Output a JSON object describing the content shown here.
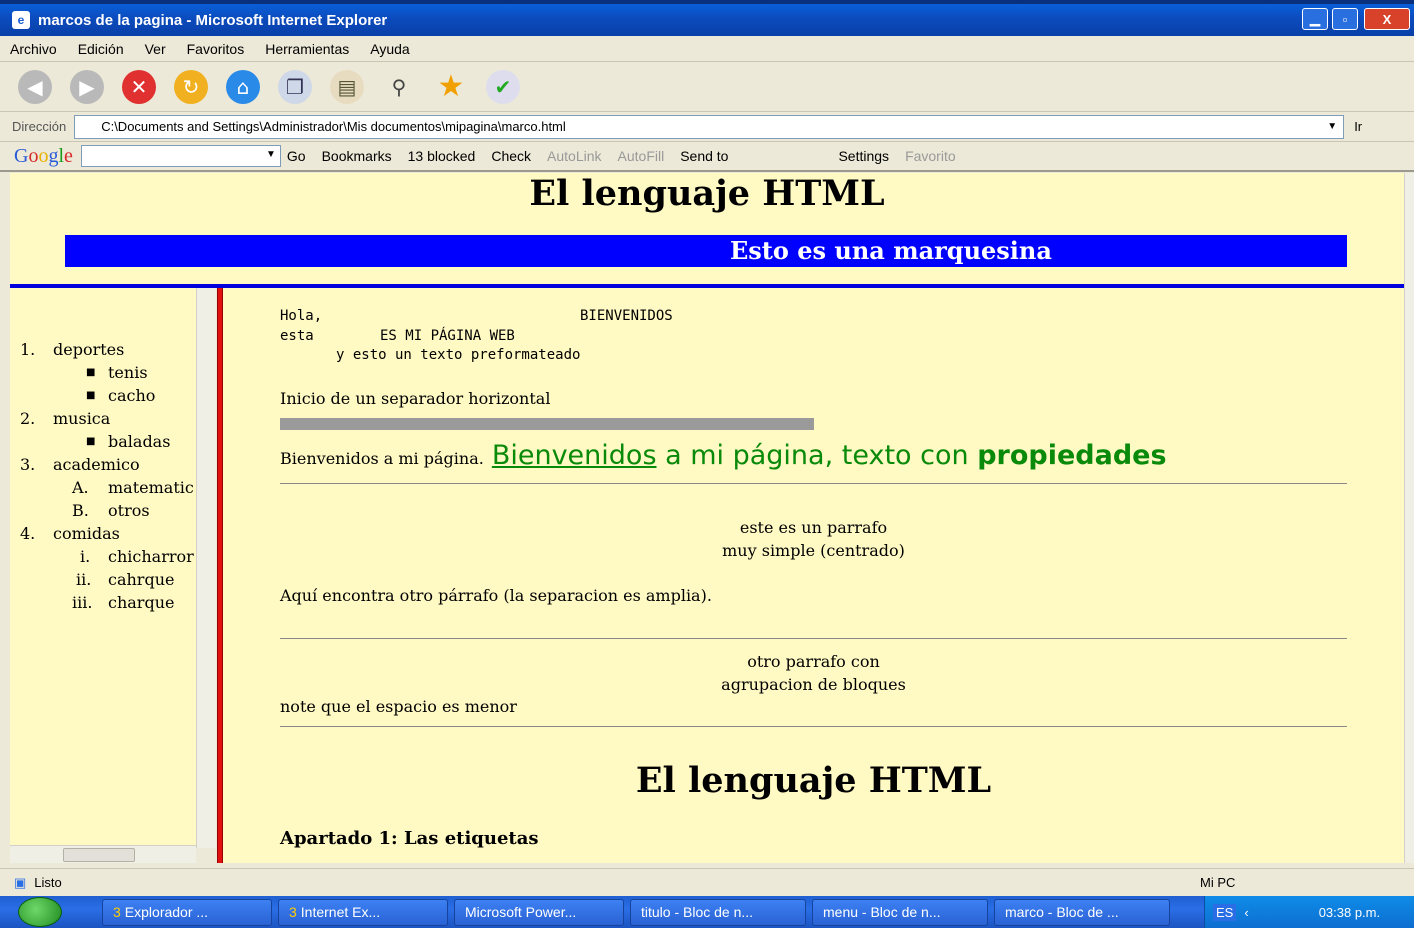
{
  "window": {
    "title": "marcos de la pagina - Microsoft Internet Explorer",
    "min": "▁",
    "max": "▫",
    "close": "X"
  },
  "menu": [
    "Archivo",
    "Edición",
    "Ver",
    "Favoritos",
    "Herramientas",
    "Ayuda"
  ],
  "address": {
    "label": "Dirección",
    "url": "C:\\Documents and Settings\\Administrador\\Mis documentos\\mipagina\\marco.html",
    "go": "Ir"
  },
  "google_toolbar": {
    "logo": "Google",
    "go": "Go",
    "bookmarks": "Bookmarks",
    "blocked": "13 blocked",
    "check": "Check",
    "autolink": "AutoLink",
    "autofill": "AutoFill",
    "send_to": "Send to",
    "settings": "Settings",
    "favorites": "Favorito"
  },
  "top_frame": {
    "heading": "El lenguaje HTML",
    "marquee": "Esto es una marquesina"
  },
  "menu_frame": {
    "items": [
      {
        "marker": "1.",
        "label": "deportes"
      },
      {
        "marker": "■",
        "label": "tenis"
      },
      {
        "marker": "■",
        "label": "cacho"
      },
      {
        "marker": "2.",
        "label": "musica"
      },
      {
        "marker": "■",
        "label": "baladas"
      },
      {
        "marker": "3.",
        "label": "academico"
      },
      {
        "marker": "A.",
        "label": "matematic"
      },
      {
        "marker": "B.",
        "label": "otros"
      },
      {
        "marker": "4.",
        "label": "comidas"
      },
      {
        "marker": "i.",
        "label": "chicharror"
      },
      {
        "marker": "ii.",
        "label": "cahrque"
      },
      {
        "marker": "iii.",
        "label": "charque"
      }
    ]
  },
  "main_frame": {
    "pre_line1_a": "Hola,",
    "pre_line1_b": "BIENVENIDOS",
    "pre_line2_a": "esta",
    "pre_line2_b": "ES MI PÁGINA WEB",
    "pre_line3": "y esto un texto preformateado",
    "hr_intro": "Inicio de un separador horizontal",
    "welcome_small": "Bienvenidos a mi página.",
    "welcome_link": "Bienvenidos",
    "welcome_mid": " a mi página, texto con ",
    "welcome_bold": "propiedades",
    "centered1": "este es un parrafo",
    "centered2": "muy simple (centrado)",
    "other_para": "Aquí encontra otro párrafo (la separacion es amplia).",
    "block1": "otro parrafo con",
    "block2": "agrupacion de bloques",
    "note": "note que el espacio es menor",
    "heading2": "El lenguaje HTML",
    "subheading": "Apartado 1: Las etiquetas"
  },
  "status": {
    "text": "Listo",
    "zone": "Mi PC"
  },
  "taskbar": {
    "tasks": [
      {
        "count": "3",
        "label": "Explorador ..."
      },
      {
        "count": "3",
        "label": "Internet Ex..."
      },
      {
        "count": "",
        "label": "Microsoft Power..."
      },
      {
        "count": "",
        "label": "titulo - Bloc de n..."
      },
      {
        "count": "",
        "label": "menu - Bloc de n..."
      },
      {
        "count": "",
        "label": "marco - Bloc de ..."
      }
    ],
    "lang": "ES",
    "clock": "03:38 p.m."
  }
}
